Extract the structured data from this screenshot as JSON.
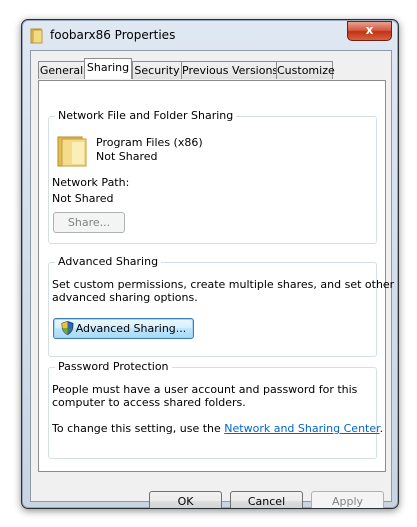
{
  "window": {
    "title": "foobarx86 Properties",
    "close_label": "x"
  },
  "tabs": [
    {
      "label": "General"
    },
    {
      "label": "Sharing"
    },
    {
      "label": "Security"
    },
    {
      "label": "Previous Versions"
    },
    {
      "label": "Customize"
    }
  ],
  "network_sharing": {
    "group_title": "Network File and Folder Sharing",
    "folder_name": "Program Files (x86)",
    "status": "Not Shared",
    "path_label": "Network Path:",
    "path_value": "Not Shared",
    "share_button": "Share..."
  },
  "advanced_sharing": {
    "group_title": "Advanced Sharing",
    "description_line1": "Set custom permissions, create multiple shares, and set other",
    "description_line2": "advanced sharing options.",
    "button_label": "Advanced Sharing..."
  },
  "password_protection": {
    "group_title": "Password Protection",
    "description_line1": "People must have a user account and password for this",
    "description_line2": "computer to access shared folders.",
    "change_text": "To change this setting, use the ",
    "link_text": "Network and Sharing Center",
    "change_suffix": "."
  },
  "footer": {
    "ok_label": "OK",
    "cancel_label": "Cancel",
    "apply_label": "Apply"
  },
  "colors": {
    "link": "#0066cc",
    "close_button": "#c8452b"
  }
}
